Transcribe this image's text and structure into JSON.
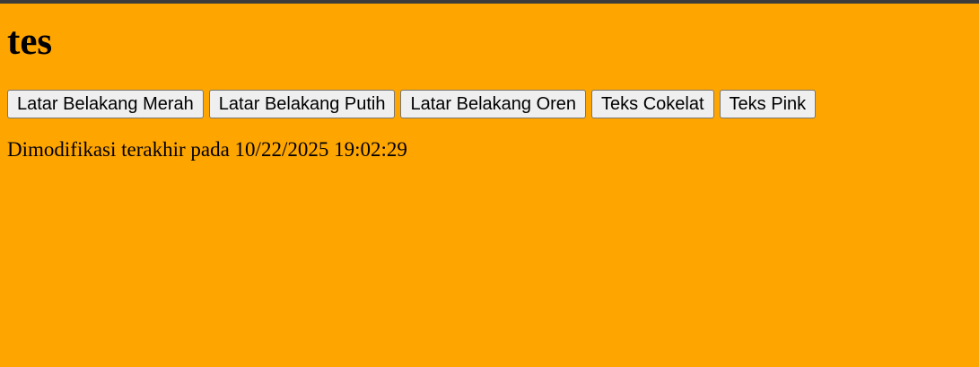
{
  "page": {
    "title": "tes",
    "background_color": "#ffa500",
    "top_border_color": "#3c3c3c"
  },
  "buttons": [
    {
      "label": "Latar Belakang Merah"
    },
    {
      "label": "Latar Belakang Putih"
    },
    {
      "label": "Latar Belakang Oren"
    },
    {
      "label": "Teks Cokelat"
    },
    {
      "label": "Teks Pink"
    }
  ],
  "footer": {
    "modified_text": "Dimodifikasi terakhir pada 10/22/2025 19:02:29"
  }
}
